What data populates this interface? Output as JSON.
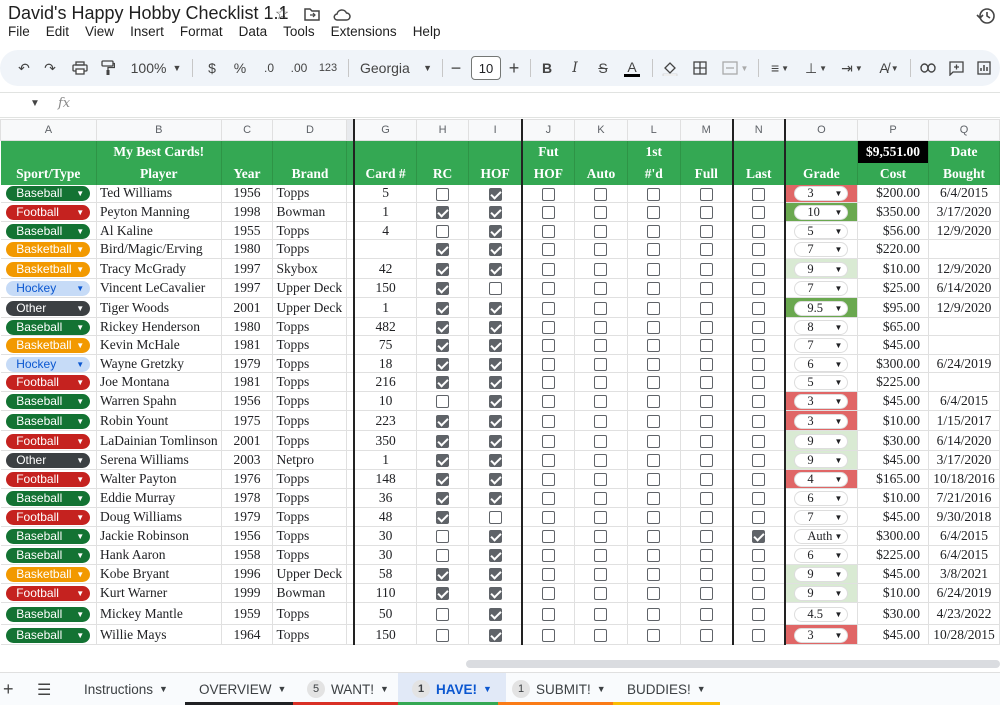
{
  "app": {
    "title": "David's Happy Hobby Checklist 1.1",
    "menu": [
      "File",
      "Edit",
      "View",
      "Insert",
      "Format",
      "Data",
      "Tools",
      "Extensions",
      "Help"
    ]
  },
  "toolbar": {
    "zoom": "100%",
    "currency": "$",
    "percent": "%",
    "dec_less": ".0",
    "dec_more": ".00",
    "number_format": "123",
    "font": "Georgia",
    "font_size": "10"
  },
  "formula_bar": {
    "fx": "fx",
    "value": ""
  },
  "columns": [
    "A",
    "B",
    "C",
    "D",
    "G",
    "H",
    "I",
    "J",
    "K",
    "L",
    "M",
    "N",
    "O",
    "P",
    "Q"
  ],
  "header_row1": [
    "",
    "My Best Cards!",
    "",
    "",
    "",
    "",
    "",
    "Fut",
    "",
    "1st",
    "",
    "",
    "",
    "$9,551.00",
    "Date"
  ],
  "header_row2": [
    "Sport/Type",
    "Player",
    "Year",
    "Brand",
    "Card #",
    "RC",
    "HOF",
    "HOF",
    "Auto",
    "#'d",
    "Full",
    "Last",
    "Grade",
    "Cost",
    "Bought"
  ],
  "colors": {
    "header_green": "#34a853",
    "baseball": "#137333",
    "football": "#c5221f",
    "basketball": "#f29900",
    "hockey": "#c6dbf7",
    "other": "#3c4043",
    "grade_red": "#e06666",
    "grade_green": "#6aa84f",
    "grade_lightgreen": "#d9ead3"
  },
  "rows": [
    {
      "sport": "Baseball",
      "player": "Ted Williams",
      "year": "1956",
      "brand": "Topps",
      "card": "5",
      "rc": false,
      "hof": true,
      "fhof": false,
      "auto": false,
      "num": false,
      "full": false,
      "last": false,
      "grade": "3",
      "gbg": "red",
      "cost": "$200.00",
      "date": "6/4/2015"
    },
    {
      "sport": "Football",
      "player": "Peyton Manning",
      "year": "1998",
      "brand": "Bowman",
      "card": "1",
      "rc": true,
      "hof": true,
      "fhof": false,
      "auto": false,
      "num": false,
      "full": false,
      "last": false,
      "grade": "10",
      "gbg": "green",
      "cost": "$350.00",
      "date": "3/17/2020"
    },
    {
      "sport": "Baseball",
      "player": "Al Kaline",
      "year": "1955",
      "brand": "Topps",
      "card": "4",
      "rc": false,
      "hof": true,
      "fhof": false,
      "auto": false,
      "num": false,
      "full": false,
      "last": false,
      "grade": "5",
      "gbg": "none",
      "cost": "$56.00",
      "date": "12/9/2020"
    },
    {
      "sport": "Basketball",
      "player": "Bird/Magic/Erving",
      "year": "1980",
      "brand": "Topps",
      "card": "",
      "rc": true,
      "hof": true,
      "fhof": false,
      "auto": false,
      "num": false,
      "full": false,
      "last": false,
      "grade": "7",
      "gbg": "none",
      "cost": "$220.00",
      "date": ""
    },
    {
      "sport": "Basketball",
      "player": "Tracy McGrady",
      "year": "1997",
      "brand": "Skybox",
      "card": "42",
      "rc": true,
      "hof": true,
      "fhof": false,
      "auto": false,
      "num": false,
      "full": false,
      "last": false,
      "grade": "9",
      "gbg": "lightgreen",
      "cost": "$10.00",
      "date": "12/9/2020"
    },
    {
      "sport": "Hockey",
      "player": "Vincent LeCavalier",
      "year": "1997",
      "brand": "Upper Deck",
      "card": "150",
      "rc": true,
      "hof": false,
      "fhof": false,
      "auto": false,
      "num": false,
      "full": false,
      "last": false,
      "grade": "7",
      "gbg": "none",
      "cost": "$25.00",
      "date": "6/14/2020"
    },
    {
      "sport": "Other",
      "player": "Tiger Woods",
      "year": "2001",
      "brand": "Upper Deck",
      "card": "1",
      "rc": true,
      "hof": true,
      "fhof": false,
      "auto": false,
      "num": false,
      "full": false,
      "last": false,
      "grade": "9.5",
      "gbg": "green",
      "cost": "$95.00",
      "date": "12/9/2020"
    },
    {
      "sport": "Baseball",
      "player": "Rickey Henderson",
      "year": "1980",
      "brand": "Topps",
      "card": "482",
      "rc": true,
      "hof": true,
      "fhof": false,
      "auto": false,
      "num": false,
      "full": false,
      "last": false,
      "grade": "8",
      "gbg": "none",
      "cost": "$65.00",
      "date": ""
    },
    {
      "sport": "Basketball",
      "player": "Kevin McHale",
      "year": "1981",
      "brand": "Topps",
      "card": "75",
      "rc": true,
      "hof": true,
      "fhof": false,
      "auto": false,
      "num": false,
      "full": false,
      "last": false,
      "grade": "7",
      "gbg": "none",
      "cost": "$45.00",
      "date": ""
    },
    {
      "sport": "Hockey",
      "player": "Wayne Gretzky",
      "year": "1979",
      "brand": "Topps",
      "card": "18",
      "rc": true,
      "hof": true,
      "fhof": false,
      "auto": false,
      "num": false,
      "full": false,
      "last": false,
      "grade": "6",
      "gbg": "none",
      "cost": "$300.00",
      "date": "6/24/2019"
    },
    {
      "sport": "Football",
      "player": "Joe Montana",
      "year": "1981",
      "brand": "Topps",
      "card": "216",
      "rc": true,
      "hof": true,
      "fhof": false,
      "auto": false,
      "num": false,
      "full": false,
      "last": false,
      "grade": "5",
      "gbg": "none",
      "cost": "$225.00",
      "date": ""
    },
    {
      "sport": "Baseball",
      "player": "Warren Spahn",
      "year": "1956",
      "brand": "Topps",
      "card": "10",
      "rc": false,
      "hof": true,
      "fhof": false,
      "auto": false,
      "num": false,
      "full": false,
      "last": false,
      "grade": "3",
      "gbg": "red",
      "cost": "$45.00",
      "date": "6/4/2015"
    },
    {
      "sport": "Baseball",
      "player": "Robin Yount",
      "year": "1975",
      "brand": "Topps",
      "card": "223",
      "rc": true,
      "hof": true,
      "fhof": false,
      "auto": false,
      "num": false,
      "full": false,
      "last": false,
      "grade": "3",
      "gbg": "red",
      "cost": "$10.00",
      "date": "1/15/2017"
    },
    {
      "sport": "Football",
      "player": "LaDainian Tomlinson",
      "year": "2001",
      "brand": "Topps",
      "card": "350",
      "rc": true,
      "hof": true,
      "fhof": false,
      "auto": false,
      "num": false,
      "full": false,
      "last": false,
      "grade": "9",
      "gbg": "lightgreen",
      "cost": "$30.00",
      "date": "6/14/2020"
    },
    {
      "sport": "Other",
      "player": "Serena Williams",
      "year": "2003",
      "brand": "Netpro",
      "card": "1",
      "rc": true,
      "hof": true,
      "fhof": false,
      "auto": false,
      "num": false,
      "full": false,
      "last": false,
      "grade": "9",
      "gbg": "lightgreen",
      "cost": "$45.00",
      "date": "3/17/2020"
    },
    {
      "sport": "Football",
      "player": "Walter Payton",
      "year": "1976",
      "brand": "Topps",
      "card": "148",
      "rc": true,
      "hof": true,
      "fhof": false,
      "auto": false,
      "num": false,
      "full": false,
      "last": false,
      "grade": "4",
      "gbg": "red",
      "cost": "$165.00",
      "date": "10/18/2016"
    },
    {
      "sport": "Baseball",
      "player": "Eddie Murray",
      "year": "1978",
      "brand": "Topps",
      "card": "36",
      "rc": true,
      "hof": true,
      "fhof": false,
      "auto": false,
      "num": false,
      "full": false,
      "last": false,
      "grade": "6",
      "gbg": "none",
      "cost": "$10.00",
      "date": "7/21/2016"
    },
    {
      "sport": "Football",
      "player": "Doug Williams",
      "year": "1979",
      "brand": "Topps",
      "card": "48",
      "rc": true,
      "hof": false,
      "fhof": false,
      "auto": false,
      "num": false,
      "full": false,
      "last": false,
      "grade": "7",
      "gbg": "none",
      "cost": "$45.00",
      "date": "9/30/2018"
    },
    {
      "sport": "Baseball",
      "player": "Jackie Robinson",
      "year": "1956",
      "brand": "Topps",
      "card": "30",
      "rc": false,
      "hof": true,
      "fhof": false,
      "auto": false,
      "num": false,
      "full": false,
      "last": true,
      "grade": "Auth",
      "gbg": "none",
      "cost": "$300.00",
      "date": "6/4/2015"
    },
    {
      "sport": "Baseball",
      "player": "Hank Aaron",
      "year": "1958",
      "brand": "Topps",
      "card": "30",
      "rc": false,
      "hof": true,
      "fhof": false,
      "auto": false,
      "num": false,
      "full": false,
      "last": false,
      "grade": "6",
      "gbg": "none",
      "cost": "$225.00",
      "date": "6/4/2015"
    },
    {
      "sport": "Basketball",
      "player": "Kobe Bryant",
      "year": "1996",
      "brand": "Upper Deck",
      "card": "58",
      "rc": true,
      "hof": true,
      "fhof": false,
      "auto": false,
      "num": false,
      "full": false,
      "last": false,
      "grade": "9",
      "gbg": "lightgreen",
      "cost": "$45.00",
      "date": "3/8/2021"
    },
    {
      "sport": "Football",
      "player": "Kurt Warner",
      "year": "1999",
      "brand": "Bowman",
      "card": "110",
      "rc": true,
      "hof": true,
      "fhof": false,
      "auto": false,
      "num": false,
      "full": false,
      "last": false,
      "grade": "9",
      "gbg": "lightgreen",
      "cost": "$10.00",
      "date": "6/24/2019"
    },
    {
      "sport": "Baseball",
      "player": "Mickey Mantle",
      "year": "1959",
      "brand": "Topps",
      "card": "50",
      "rc": false,
      "hof": true,
      "fhof": false,
      "auto": false,
      "num": false,
      "full": false,
      "last": false,
      "grade": "4.5",
      "gbg": "none",
      "cost": "$30.00",
      "date": "4/23/2022"
    },
    {
      "sport": "Baseball",
      "player": "Willie Mays",
      "year": "1964",
      "brand": "Topps",
      "card": "150",
      "rc": false,
      "hof": true,
      "fhof": false,
      "auto": false,
      "num": false,
      "full": false,
      "last": false,
      "grade": "3",
      "gbg": "red",
      "cost": "$45.00",
      "date": "10/28/2015"
    }
  ],
  "sheets": [
    {
      "label": "Instructions",
      "badge": "",
      "active": false,
      "underline": ""
    },
    {
      "label": "OVERVIEW",
      "badge": "",
      "active": false,
      "underline": "#202124"
    },
    {
      "label": "WANT!",
      "badge": "5",
      "active": false,
      "underline": "#d93025"
    },
    {
      "label": "HAVE!",
      "badge": "1",
      "active": true,
      "underline": "#34a853"
    },
    {
      "label": "SUBMIT!",
      "badge": "1",
      "active": false,
      "underline": "#fa7b17"
    },
    {
      "label": "BUDDIES!",
      "badge": "",
      "active": false,
      "underline": "#fbbc04"
    }
  ]
}
